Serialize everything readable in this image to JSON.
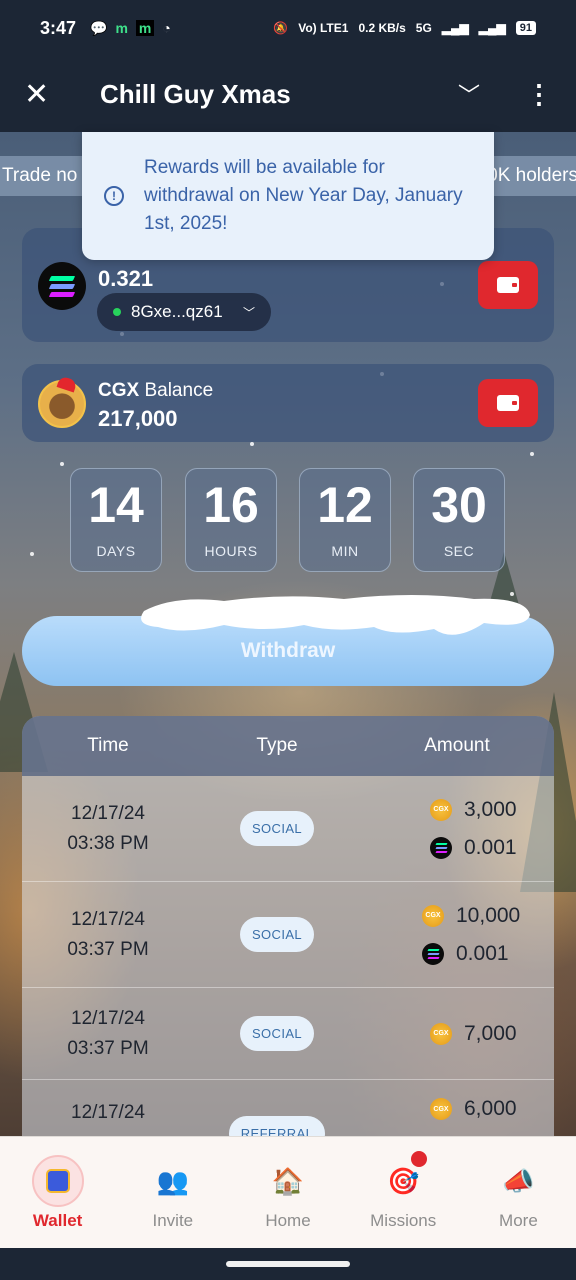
{
  "status": {
    "time": "3:47",
    "net": "Vo) LTE1",
    "speed": "0.2 KB/s",
    "gen": "5G",
    "battery": "91"
  },
  "appbar": {
    "title": "Chill Guy Xmas"
  },
  "ticker": {
    "left": "Trade no",
    "right": "0K holders"
  },
  "tooltip": {
    "text": "Rewards will be available for withdrawal on New Year Day, January 1st, 2025!"
  },
  "sol_wallet": {
    "amount": "0.321",
    "address": "8Gxe...qz61"
  },
  "cgx_wallet": {
    "token": "CGX",
    "label": "Balance",
    "amount": "217,000"
  },
  "countdown": [
    {
      "value": "14",
      "label": "DAYS"
    },
    {
      "value": "16",
      "label": "HOURS"
    },
    {
      "value": "12",
      "label": "MIN"
    },
    {
      "value": "30",
      "label": "SEC"
    }
  ],
  "withdraw_label": "Withdraw",
  "table": {
    "headers": [
      "Time",
      "Type",
      "Amount"
    ],
    "rows": [
      {
        "date": "12/17/24",
        "time": "03:38 PM",
        "type": "SOCIAL",
        "amounts": [
          {
            "coin": "CGX",
            "value": "3,000"
          },
          {
            "coin": "SOL",
            "value": "0.001"
          }
        ]
      },
      {
        "date": "12/17/24",
        "time": "03:37 PM",
        "type": "SOCIAL",
        "amounts": [
          {
            "coin": "CGX",
            "value": "10,000"
          },
          {
            "coin": "SOL",
            "value": "0.001"
          }
        ]
      },
      {
        "date": "12/17/24",
        "time": "03:37 PM",
        "type": "SOCIAL",
        "amounts": [
          {
            "coin": "CGX",
            "value": "7,000"
          }
        ]
      },
      {
        "date": "12/17/24",
        "time": "",
        "type": "REFERRAL",
        "amounts": [
          {
            "coin": "CGX",
            "value": "6,000"
          }
        ]
      }
    ]
  },
  "nav": [
    {
      "label": "Wallet",
      "icon": "wallet-icon",
      "active": true
    },
    {
      "label": "Invite",
      "icon": "invite-icon",
      "active": false
    },
    {
      "label": "Home",
      "icon": "home-icon",
      "active": false
    },
    {
      "label": "Missions",
      "icon": "target-icon",
      "active": false
    },
    {
      "label": "More",
      "icon": "megaphone-icon",
      "active": false
    }
  ],
  "colors": {
    "accent": "#e0282e",
    "tooltip_text": "#3a63a8",
    "appbar": "#1c2635"
  }
}
